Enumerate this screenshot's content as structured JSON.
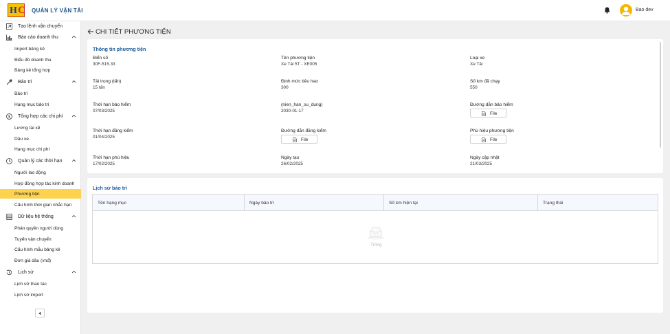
{
  "app": {
    "title": "QUẢN LÝ VẬN TẢI",
    "logo_text": "HC"
  },
  "header": {
    "user_name": "Bao dev"
  },
  "sidebar": {
    "top_item": "Tạo lệnh vận chuyển",
    "groups": [
      {
        "label": "Báo cáo doanh thu",
        "icon": "bar-chart-icon",
        "items": [
          "Import bảng kê",
          "Biểu đồ doanh thu",
          "Bảng kê tổng hợp"
        ]
      },
      {
        "label": "Bảo trì",
        "icon": "wrench-icon",
        "items": [
          "Bảo trì",
          "Hạng mục bảo trì"
        ]
      },
      {
        "label": "Tổng hợp các chi phí",
        "icon": "dollar-icon",
        "items": [
          "Lương tài xế",
          "Dầu xe",
          "Hạng mục chi phí"
        ]
      },
      {
        "label": "Quản lý các thời hạn",
        "icon": "clock-icon",
        "items": [
          "Người lao động",
          "Hợp đồng hợp tác kinh doanh",
          "Phương tiện",
          "Cấu hình thời gian nhắc hạn"
        ]
      },
      {
        "label": "Dữ liệu hệ thống",
        "icon": "database-icon",
        "items": [
          "Phân quyền người dùng",
          "Tuyến vận chuyển",
          "Cấu hình mẫu bảng kê",
          "Đơn giá dầu (vnđ)"
        ]
      },
      {
        "label": "Lịch sử",
        "icon": "history-icon",
        "items": [
          "Lịch sử thao tác",
          "Lịch sử import"
        ]
      }
    ],
    "active_item": "Phương tiện"
  },
  "page": {
    "title": "CHI TIẾT PHƯƠNG TIỆN",
    "info_section": {
      "title": "Thông tin phương tiện",
      "bien_so": {
        "label": "Biển số",
        "value": "30F-515.33"
      },
      "ten_phuong_tien": {
        "label": "Tên phương tiện",
        "value": "Xe Tải 5T - XE005"
      },
      "loai_xe": {
        "label": "Loại xe",
        "value": "Xe Tải"
      },
      "tai_trong": {
        "label": "Tải trọng (tấn)",
        "value": "15 tấn"
      },
      "dinh_muc": {
        "label": "Định mức tiêu hao",
        "value": "300"
      },
      "so_km": {
        "label": "Số km đã chạy",
        "value": "550"
      },
      "han_bao_hiem": {
        "label": "Thời hạn bảo hiểm",
        "value": "07/03/2025"
      },
      "nien_han": {
        "label": "(nien_han_su_dung)",
        "value": "2030-01-17"
      },
      "duong_dan_bao_hiem": {
        "label": "Đường dẫn bảo hiểm",
        "button": "File"
      },
      "han_dang_kiem": {
        "label": "Thời hạn đăng kiểm",
        "value": "01/04/2025"
      },
      "duong_dan_dang_kiem": {
        "label": "Đường dẫn đăng kiểm",
        "button": "File"
      },
      "phu_hieu": {
        "label": "Phù hiệu phương tiện",
        "button": "File"
      },
      "han_phu_hieu": {
        "label": "Thời hạn phù hiệu",
        "value": "17/02/2025"
      },
      "ngay_tao": {
        "label": "Ngày tạo",
        "value": "26/02/2025"
      },
      "ngay_cap_nhat": {
        "label": "Ngày cập nhật",
        "value": "21/03/2025"
      }
    },
    "history_section": {
      "title": "Lịch sử bảo trì",
      "columns": [
        "Tên hạng mục",
        "Ngày bảo trì",
        "Số km hiện tại",
        "Trạng thái"
      ],
      "empty_text": "Trống"
    }
  },
  "colors": {
    "accent": "#fcd24e",
    "brand": "#1a4f8b",
    "section_title": "#1a5a96"
  }
}
